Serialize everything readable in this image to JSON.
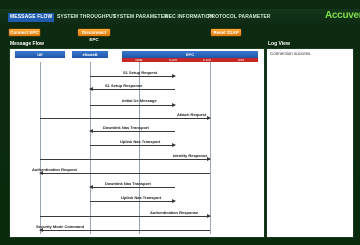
{
  "brand": "Accuver",
  "tabs": [
    "MESSAGE FLOW",
    "SYSTEM THROUGHPUT",
    "SYSTEM PARAMETER",
    "NEC INFORMATION",
    "PROTOCOL PARAMETER"
  ],
  "buttons": {
    "connect": "Connect EPC",
    "disconnect": "Disconnect EPC",
    "reset": "Reset S1AP"
  },
  "sections": {
    "message_flow": "Message Flow",
    "log_view": "Log View"
  },
  "log": {
    "lines": [
      "Connection success."
    ]
  },
  "entities": {
    "ue": "UE",
    "enodeb": "eNodeB",
    "epc": "EPC",
    "epc_parts": [
      "MME",
      "S-GW",
      "P-GW",
      "HSS"
    ]
  },
  "messages": [
    {
      "label": "S1 Setup Request",
      "dir": "right"
    },
    {
      "label": "S1 Setup Response",
      "dir": "left"
    },
    {
      "label": "Initial Ue Message",
      "dir": "right"
    },
    {
      "label": "Attach Request",
      "dir": "right"
    },
    {
      "label": "Downlink Nas Transport",
      "dir": "left"
    },
    {
      "label": "Uplink Nas Transport",
      "dir": "right"
    },
    {
      "label": "Identity Response",
      "dir": "right"
    },
    {
      "label": "Authentication Request",
      "dir": "left"
    },
    {
      "label": "Downlink Nas Transport",
      "dir": "left"
    },
    {
      "label": "Uplink Nas Transport",
      "dir": "right"
    },
    {
      "label": "Authentication Response",
      "dir": "right"
    },
    {
      "label": "Security Mode Command",
      "dir": "left"
    }
  ]
}
